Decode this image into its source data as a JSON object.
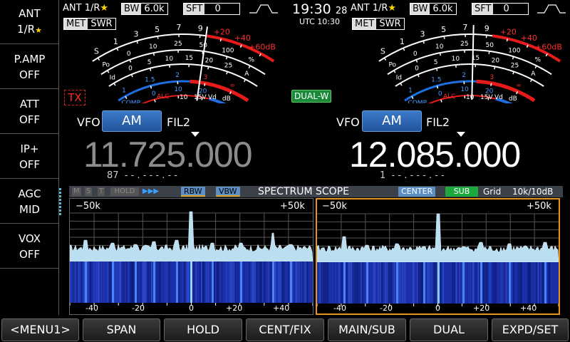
{
  "sidebar": {
    "items": [
      {
        "label": "ANT",
        "value": "1/R",
        "star": "★"
      },
      {
        "label": "P.AMP",
        "value": "OFF"
      },
      {
        "label": "ATT",
        "value": "OFF"
      },
      {
        "label": "IP+",
        "value": "OFF"
      },
      {
        "label": "AGC",
        "value": "MID"
      },
      {
        "label": "VOX",
        "value": "OFF"
      }
    ]
  },
  "clock": {
    "time": "19:30",
    "seconds": "28",
    "utc": "UTC 10:30"
  },
  "main": {
    "ant": "ANT 1/R",
    "ant_star": "★",
    "bw_label": "BW",
    "bw_value": "6.0k",
    "sft_label": "SFT",
    "sft_value": "0",
    "met_label": "MET",
    "met_mode": "SWR",
    "tx": "TX",
    "vfo_label": "VFO",
    "mode": "AM",
    "filter": "FIL2",
    "frequency": "11.725.000",
    "sub_value": "87",
    "sub_dashes": "- - . - - - . - -"
  },
  "sub": {
    "ant": "ANT 1/R",
    "ant_star": "★",
    "bw_label": "BW",
    "bw_value": "6.0k",
    "sft_label": "SFT",
    "sft_value": "0",
    "met_label": "MET",
    "met_mode": "SWR",
    "dual": "DUAL-W",
    "vfo_label": "VFO",
    "mode": "AM",
    "filter": "FIL2",
    "frequency": "12.085.000",
    "sub_value": "1",
    "sub_dashes": "- - . - - - . - -"
  },
  "meter": {
    "s_scale": [
      "S",
      "1",
      "3",
      "5",
      "7",
      "9",
      "+20",
      "+40",
      "+60dB"
    ],
    "po_scale": [
      "Po",
      "0",
      "10",
      "25",
      "50",
      "100",
      "%"
    ],
    "id_scale": [
      "Id",
      "0",
      "5",
      "10",
      "15",
      "20",
      "25",
      "A"
    ],
    "swr_scale": [
      "1",
      "1.5",
      "2",
      "3",
      "∞"
    ],
    "comp_scale": [
      "COMP",
      "0",
      "10",
      "20",
      "dB"
    ],
    "alc_label": "ALC",
    "vd_scale": [
      "10",
      "15V",
      "Vd"
    ]
  },
  "scope": {
    "mst": [
      "M",
      "S",
      "T"
    ],
    "hold": "HOLD",
    "arrows": "▶▶▶",
    "rbw": "RBW",
    "vbw": "VBW",
    "title": "SPECTRUM SCOPE",
    "center": "CENTER",
    "sub": "SUB",
    "grid": "Grid",
    "span_info": "10k/10dB",
    "left_span": "−50k",
    "right_span": "+50k",
    "ticks": [
      "-40",
      "-20",
      "0",
      "+20",
      "+40"
    ]
  },
  "bottom_buttons": [
    "<MENU1>",
    "SPAN",
    "HOLD",
    "CENT/FIX",
    "MAIN/SUB",
    "DUAL",
    "EXPD/SET"
  ],
  "colors": {
    "accent_blue": "#3a78c8",
    "meter_red": "#e81b1b",
    "meter_blue": "#1e6ee0",
    "scope_fill": "#b9dff0",
    "waterfall": "#1a2fa8",
    "selected_border": "#e89420",
    "sub_green": "#1ca83c"
  }
}
